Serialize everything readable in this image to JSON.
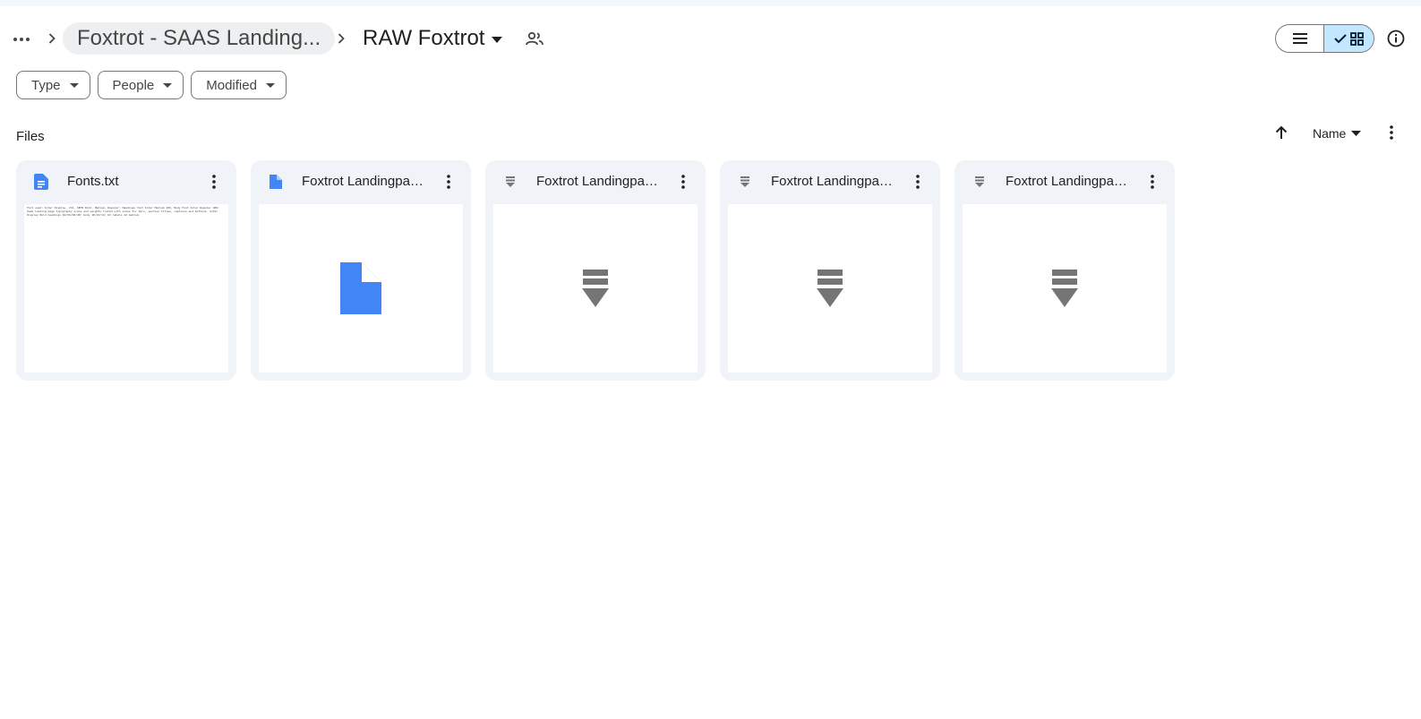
{
  "breadcrumb": {
    "parent": "Foxtrot - SAAS Landing...",
    "current": "RAW Foxtrot"
  },
  "icons": {
    "more": "more-horiz-icon",
    "separator": "chevron-right-icon",
    "caret": "caret-down-icon",
    "shared": "shared-folder-icon",
    "list_view": "list-view-icon",
    "grid_view": "grid-view-icon",
    "check": "check-icon",
    "info": "info-icon",
    "sort_direction": "arrow-up-icon",
    "kebab": "more-vert-icon",
    "doc": "document-icon",
    "font": "font-file-icon"
  },
  "colors": {
    "accent": "#0b57d0",
    "doc_blue": "#4285f4",
    "grid_selected": "#c2e7ff",
    "card_bg": "#f0f4f9",
    "font_gray": "#757575"
  },
  "filters": [
    {
      "label": "Type"
    },
    {
      "label": "People"
    },
    {
      "label": "Modified"
    }
  ],
  "files_section": {
    "label": "Files",
    "sort_label": "Name"
  },
  "files": [
    {
      "name": "Fonts.txt",
      "kind": "text",
      "preview": "Font used: Inter Display, CSS, SEMI Bold, Medium, Regular; Headings font Inter Medium 100, Body Font Inter Regular 400; SaaS landing page typography scale and weights listed with sizes for hero, section titles, captions and buttons. Inter Display Bold headings 64/56/48/40; body 18/16/14; UI labels 12 medium."
    },
    {
      "name": "Foxtrot Landingpag...",
      "kind": "doc"
    },
    {
      "name": "Foxtrot Landingpag...",
      "kind": "font"
    },
    {
      "name": "Foxtrot Landingpag...",
      "kind": "font"
    },
    {
      "name": "Foxtrot Landingpag...",
      "kind": "font"
    }
  ]
}
